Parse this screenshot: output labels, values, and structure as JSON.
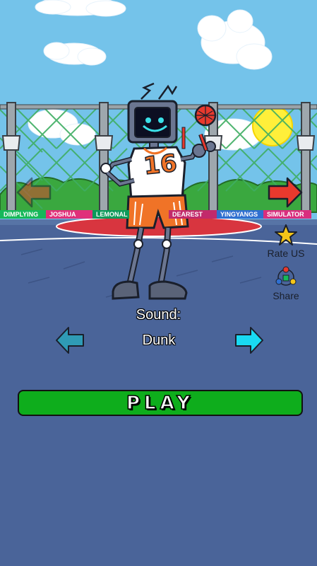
{
  "scene": {
    "banner_names": [
      "DIMPLYING",
      "JOSHUA",
      "LEMONAL",
      "DEAREST",
      "YINGYANGS",
      "SIMULATOR"
    ],
    "jersey_number": "16"
  },
  "side_menu": {
    "rate_label": "Rate US",
    "share_label": "Share",
    "rate_icon": "star-icon",
    "share_icon": "share-network-icon"
  },
  "sound": {
    "title": "Sound:",
    "selected": "Dunk"
  },
  "play": {
    "label": "PLAY"
  },
  "colors": {
    "background": "#4a6499",
    "play_button": "#0ead1c",
    "arrow_cyan": "#19d9f2",
    "arrow_cyan_dim": "#2f9bb5",
    "arrow_red": "#e8392d",
    "star": "#f5c518"
  }
}
